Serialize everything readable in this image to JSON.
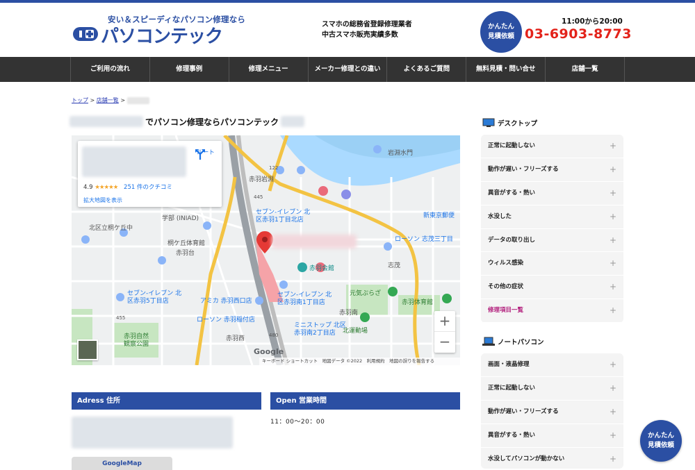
{
  "header": {
    "logo_tagline": "安い＆スピーディなパソコン修理なら",
    "logo_text": "パソコンテック",
    "info_line1": "スマホの総務省登録修理業者",
    "info_line2": "中古スマホ販売実績多数",
    "quote_line1": "かんたん",
    "quote_line2": "見積依頼",
    "hours": "11:00から20:00",
    "phone": "03-6903-8773",
    "brand_color": "#2b4fa3",
    "phone_color": "#e3231b"
  },
  "nav": {
    "items": [
      {
        "label": "ご利用の流れ"
      },
      {
        "label": "修理事例"
      },
      {
        "label": "修理メニュー"
      },
      {
        "label": "メーカー修理との違い"
      },
      {
        "label": "よくあるご質問"
      },
      {
        "label": "無料見積・問い合せ"
      },
      {
        "label": "店舗一覧"
      }
    ]
  },
  "breadcrumb": {
    "home": "トップ",
    "sep1": ">",
    "stores": "店舗一覧",
    "sep2": ">"
  },
  "page": {
    "title": "でパソコン修理ならパソコンテック"
  },
  "map": {
    "rating": "4.9",
    "stars": "★★★★★",
    "reviews": "251 件のクチコミ",
    "route": "ルート",
    "enlarge": "拡大地図を表示",
    "zoom_in": "+",
    "zoom_out": "−",
    "google": "Google",
    "footer": "キーボード ショートカット　地図データ ©2022　利用規約　地図の誤りを報告する",
    "labels": [
      "岩淵水門",
      "赤羽岩淵",
      "セブン-イレブン 北",
      "区赤羽1丁目北店",
      "学部 (INIAD)",
      "北区立桐ケ丘中",
      "桐ケ丘体育館",
      "赤羽台",
      "赤羽会館",
      "ローソン 志茂三丁目",
      "志茂",
      "新東京郵便",
      "セブン-イレブン 北",
      "区赤羽5丁目店",
      "アミカ 赤羽西口店",
      "セブン-イレブン 北",
      "区赤羽南1丁目店",
      "元気ぷらざ",
      "赤羽体育館",
      "ローソン 赤羽稲付店",
      "赤羽南",
      "北運動場",
      "ミニストップ 北区",
      "赤羽南2丁目店",
      "赤羽自然",
      "観察公園",
      "赤羽西",
      "122",
      "445",
      "455",
      "480"
    ]
  },
  "address": {
    "heading": "Adress 住所",
    "button": "GoogleMap"
  },
  "open": {
    "heading": "Open 営業時間",
    "hours": "11：00〜20：00"
  },
  "sidebar": {
    "desktop_title": "デスクトップ",
    "desktop_items": [
      {
        "label": "正常に起動しない"
      },
      {
        "label": "動作が遅い・フリーズする"
      },
      {
        "label": "異音がする・熱い"
      },
      {
        "label": "水没した"
      },
      {
        "label": "データの取り出し"
      },
      {
        "label": "ウィルス感染"
      },
      {
        "label": "その他の症状"
      },
      {
        "label": "修理項目一覧"
      }
    ],
    "notebook_title": "ノートパソコン",
    "notebook_items": [
      {
        "label": "画面・液晶修理"
      },
      {
        "label": "正常に起動しない"
      },
      {
        "label": "動作が遅い・フリーズする"
      },
      {
        "label": "異音がする・熱い"
      },
      {
        "label": "水没してパソコンが動かない"
      }
    ],
    "plus": "+",
    "active_color": "#b21e7c"
  },
  "float_quote": {
    "line1": "かんたん",
    "line2": "見積依頼"
  }
}
